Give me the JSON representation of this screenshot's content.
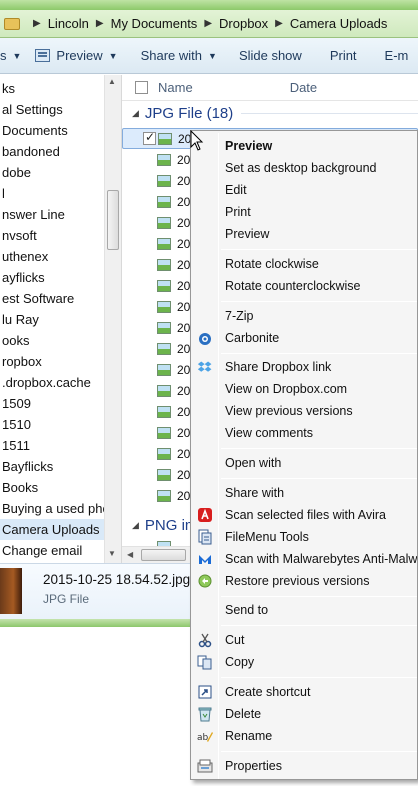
{
  "breadcrumb": {
    "items": [
      "Lincoln",
      "My Documents",
      "Dropbox",
      "Camera Uploads"
    ]
  },
  "toolbar": {
    "organize_partial": "s",
    "preview_label": "Preview",
    "share_label": "Share with",
    "slideshow_label": "Slide show",
    "print_label": "Print",
    "email_partial": "E-m"
  },
  "nav": {
    "items": [
      "ks",
      "al Settings",
      " Documents",
      "bandoned",
      "dobe",
      "l",
      "nswer Line",
      "nvsoft",
      "uthenex",
      "ayflicks",
      "est Software",
      "lu Ray",
      "ooks",
      "ropbox",
      ".dropbox.cache",
      "1509",
      "1510",
      "1511",
      "Bayflicks",
      "Books",
      "Buying a used phor",
      "Camera Uploads",
      "Change email"
    ],
    "selected_index": 21
  },
  "filelist": {
    "col_name": "Name",
    "col_date": "Date",
    "group_jpg": "JPG File (18)",
    "group_png": "PNG im",
    "row_prefix": "201",
    "row_prefix_short": "20"
  },
  "details": {
    "filename": "2015-10-25 18.54.52.jpg",
    "filetype": "JPG File"
  },
  "context_menu": {
    "preview_bold": "Preview",
    "set_desktop": "Set as desktop background",
    "edit": "Edit",
    "print": "Print",
    "preview": "Preview",
    "rotate_cw": "Rotate clockwise",
    "rotate_ccw": "Rotate counterclockwise",
    "zip": "7-Zip",
    "carbonite": "Carbonite",
    "share_dropbox": "Share Dropbox link",
    "view_dropbox": "View on Dropbox.com",
    "view_versions": "View previous versions",
    "view_comments": "View comments",
    "open_with": "Open with",
    "share_with": "Share with",
    "scan_avira": "Scan selected files with Avira",
    "filemenu": "FileMenu Tools",
    "scan_malwarebytes": "Scan with Malwarebytes Anti-Malw",
    "restore_versions": "Restore previous versions",
    "send_to": "Send to",
    "cut": "Cut",
    "copy": "Copy",
    "create_shortcut": "Create shortcut",
    "delete": "Delete",
    "rename": "Rename",
    "properties": "Properties"
  }
}
